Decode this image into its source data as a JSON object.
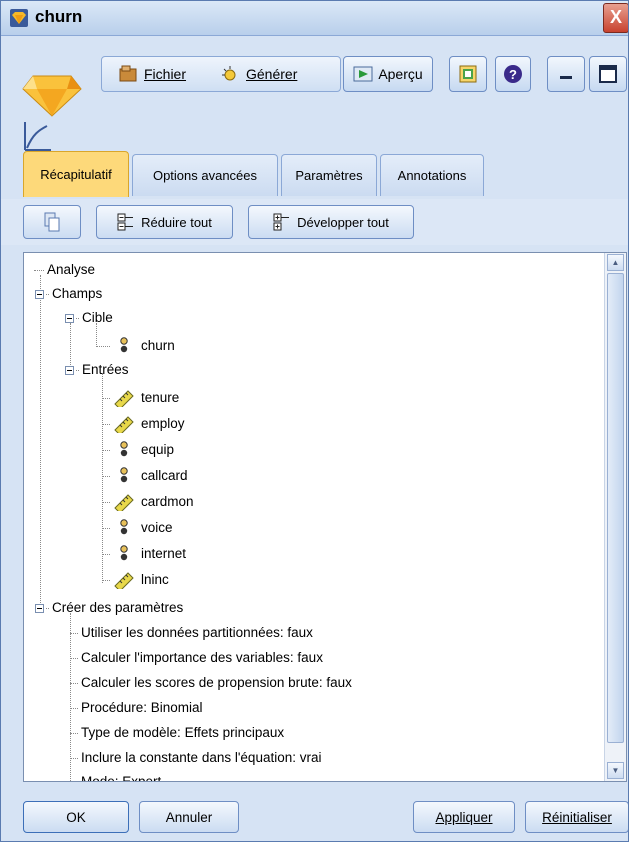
{
  "window": {
    "title": "churn",
    "close_label": "X"
  },
  "toolbar": {
    "file_label": "Fichier",
    "generate_label": "Générer",
    "preview_label": "Aperçu"
  },
  "tabs": [
    {
      "label": "Récapitulatif",
      "active": true
    },
    {
      "label": "Options avancées",
      "active": false
    },
    {
      "label": "Paramètres",
      "active": false
    },
    {
      "label": "Annotations",
      "active": false
    }
  ],
  "panel": {
    "collapse_label": "Réduire tout",
    "expand_label": "Développer tout"
  },
  "tree": {
    "analyse": "Analyse",
    "champs": "Champs",
    "cible": "Cible",
    "target_field": "churn",
    "entrees": "Entrées",
    "inputs": [
      {
        "name": "tenure",
        "type": "ruler-icon"
      },
      {
        "name": "employ",
        "type": "ruler-icon"
      },
      {
        "name": "equip",
        "type": "flag-icon"
      },
      {
        "name": "callcard",
        "type": "flag-icon"
      },
      {
        "name": "cardmon",
        "type": "ruler-icon"
      },
      {
        "name": "voice",
        "type": "flag-icon"
      },
      {
        "name": "internet",
        "type": "flag-icon"
      },
      {
        "name": "lninc",
        "type": "ruler-icon"
      }
    ],
    "build_settings": "Créer des paramètres",
    "settings": [
      "Utiliser les données partitionnées: faux",
      "Calculer l'importance des variables: faux",
      "Calculer les scores de propension brute: faux",
      "Procédure: Binomial",
      "Type de modèle: Effets principaux",
      "Inclure la constante dans l'équation: vrai",
      "Mode: Expert"
    ]
  },
  "buttons": {
    "ok": "OK",
    "cancel": "Annuler",
    "apply": "Appliquer",
    "reset": "Réinitialiser"
  },
  "colors": {
    "window_bg": "#d6e3f4",
    "active_tab": "#fdd97a",
    "close_button": "#c8422f"
  }
}
